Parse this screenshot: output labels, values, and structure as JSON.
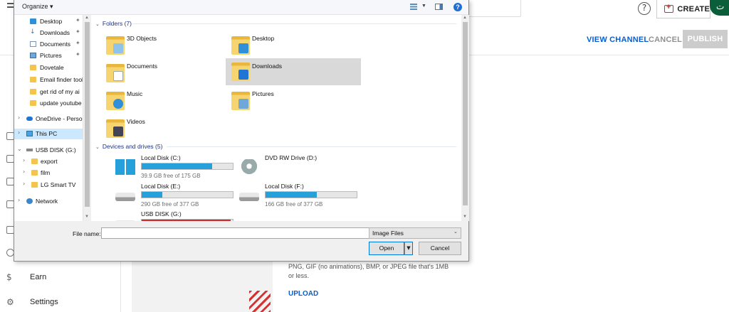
{
  "youtube": {
    "create_label": "CREATE",
    "avatar_letter": "ت",
    "help_symbol": "?",
    "view_channel": "VIEW CHANNEL",
    "cancel": "CANCEL",
    "publish": "PUBLISH",
    "sidebar": {
      "earn": "Earn",
      "settings": "Settings"
    },
    "hint": "PNG, GIF (no animations), BMP, or JPEG file that's 1MB or less.",
    "upload": "UPLOAD"
  },
  "dialog": {
    "organize": "Organize ▾",
    "nav": {
      "quick": [
        {
          "label": "Desktop",
          "icon": "desktop-icon",
          "pinned": true
        },
        {
          "label": "Downloads",
          "icon": "download-icon",
          "pinned": true
        },
        {
          "label": "Documents",
          "icon": "document-icon",
          "pinned": true
        },
        {
          "label": "Pictures",
          "icon": "pictures-icon",
          "pinned": true
        },
        {
          "label": "Dovetale",
          "icon": "folder-icon"
        },
        {
          "label": "Email finder tool",
          "icon": "folder-icon"
        },
        {
          "label": "get rid of my ai",
          "icon": "folder-icon"
        },
        {
          "label": "update youtube",
          "icon": "folder-icon"
        }
      ],
      "onedrive": "OneDrive - Person",
      "this_pc": "This PC",
      "usb": "USB DISK (G:)",
      "usb_children": [
        "export",
        "film",
        "LG Smart TV"
      ],
      "network": "Network"
    },
    "folders_header": "Folders (7)",
    "folders": [
      {
        "label": "3D Objects",
        "icon": "3d-objects-folder-icon"
      },
      {
        "label": "Desktop",
        "icon": "desktop-folder-icon"
      },
      {
        "label": "Documents",
        "icon": "documents-folder-icon"
      },
      {
        "label": "Downloads",
        "icon": "downloads-folder-icon",
        "selected": true
      },
      {
        "label": "Music",
        "icon": "music-folder-icon"
      },
      {
        "label": "Pictures",
        "icon": "pictures-folder-icon"
      },
      {
        "label": "Videos",
        "icon": "videos-folder-icon"
      }
    ],
    "devices_header": "Devices and drives (5)",
    "drives": [
      {
        "name": "Local Disk (C:)",
        "free": "39.9 GB free of 175 GB",
        "used_fraction": 0.77,
        "icon": "windows-drive-icon"
      },
      {
        "name": "DVD RW Drive (D:)",
        "icon": "dvd-drive-icon"
      },
      {
        "name": "Local Disk (E:)",
        "free": "290 GB free of 377 GB",
        "used_fraction": 0.23,
        "icon": "hard-disk-icon"
      },
      {
        "name": "Local Disk (F:)",
        "free": "166 GB free of 377 GB",
        "used_fraction": 0.56,
        "icon": "hard-disk-icon"
      },
      {
        "name": "USB DISK (G:)",
        "used_fraction": 0.98,
        "icon": "usb-drive-icon"
      }
    ],
    "file_name_label": "File name:",
    "file_name_value": "",
    "file_type": "Image Files",
    "open": "Open",
    "cancel": "Cancel"
  }
}
